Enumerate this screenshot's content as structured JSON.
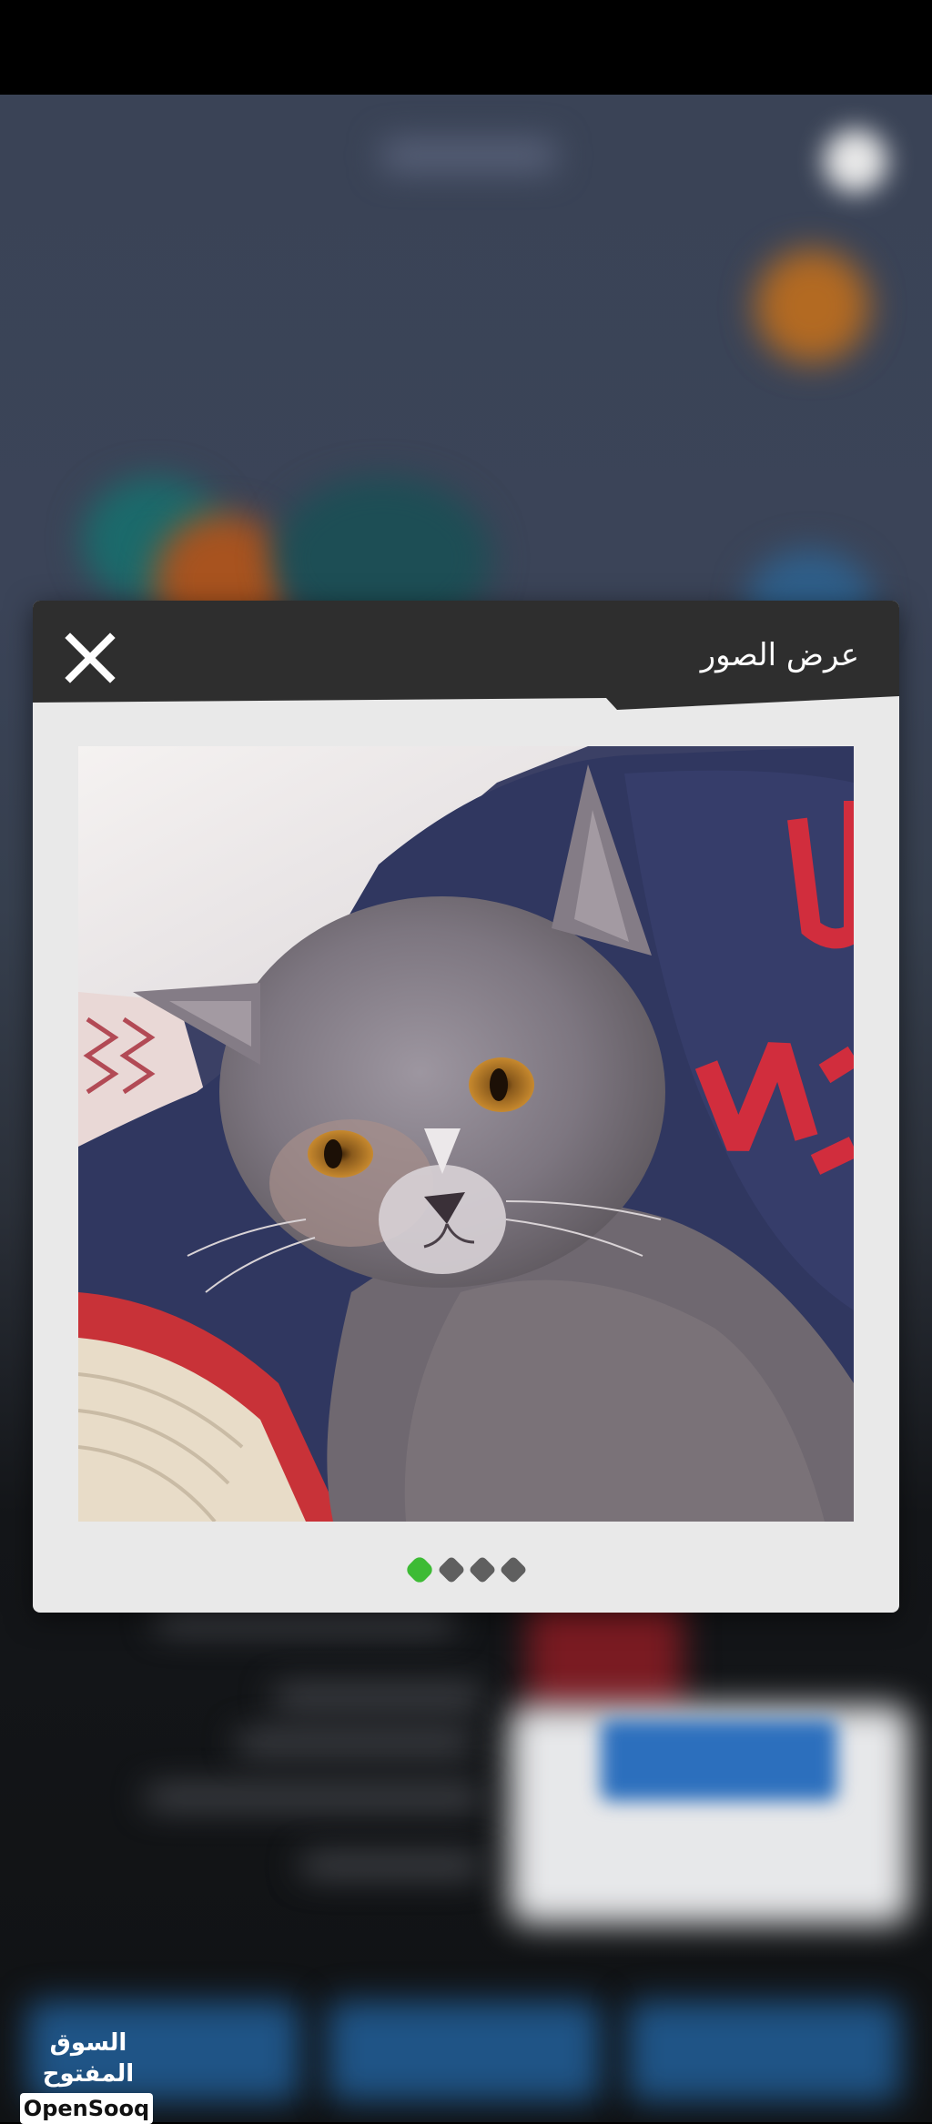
{
  "dialog": {
    "title": "عرض الصور",
    "close_icon": "close-icon",
    "photo_count": 4,
    "active_photo_index": 0
  },
  "photo": {
    "subject": "grey kitten",
    "sweater_text": "AN"
  },
  "colors": {
    "header_bg": "#2e2e2e",
    "dialog_bg": "#e9e9e9",
    "active_dot": "#3dbb35",
    "inactive_dot": "#5f5f5f"
  },
  "watermark": {
    "arabic": "السوق المفتوح",
    "latin": "OpenSooq"
  }
}
